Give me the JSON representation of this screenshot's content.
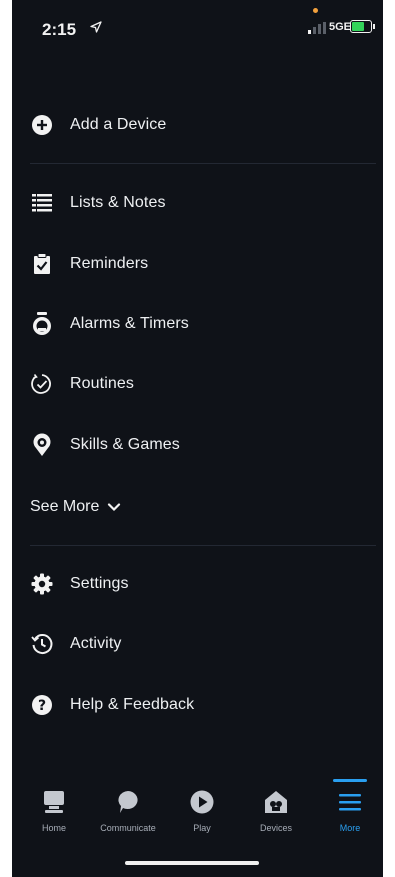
{
  "status_bar": {
    "time": "2:15",
    "network": "5GE",
    "battery_color": "#33d35a",
    "icons": [
      "location-arrow-icon",
      "signal-bars-icon",
      "battery-charging-icon"
    ]
  },
  "menu": {
    "add_device": {
      "label": "Add a Device",
      "icon": "plus-circle-icon"
    },
    "items": [
      {
        "label": "Lists & Notes",
        "icon": "list-icon"
      },
      {
        "label": "Reminders",
        "icon": "clipboard-check-icon"
      },
      {
        "label": "Alarms & Timers",
        "icon": "alarm-clock-icon"
      },
      {
        "label": "Routines",
        "icon": "routine-check-icon"
      },
      {
        "label": "Skills & Games",
        "icon": "skills-pin-icon"
      }
    ],
    "see_more": {
      "label": "See More",
      "icon": "chevron-down-icon"
    },
    "bottom_items": [
      {
        "label": "Settings",
        "icon": "gear-icon"
      },
      {
        "label": "Activity",
        "icon": "history-icon"
      },
      {
        "label": "Help & Feedback",
        "icon": "question-circle-icon"
      }
    ]
  },
  "tab_bar": {
    "accent_color": "#2a9ff0",
    "tabs": [
      {
        "label": "Home",
        "icon": "home-display-icon",
        "active": false
      },
      {
        "label": "Communicate",
        "icon": "speech-bubble-icon",
        "active": false
      },
      {
        "label": "Play",
        "icon": "play-circle-icon",
        "active": false
      },
      {
        "label": "Devices",
        "icon": "devices-house-icon",
        "active": false
      },
      {
        "label": "More",
        "icon": "hamburger-menu-icon",
        "active": true
      }
    ]
  }
}
